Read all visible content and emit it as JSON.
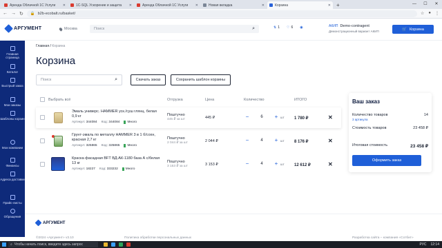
{
  "browser": {
    "tabs": [
      {
        "label": "Аренда Облачной 1С Услуги",
        "active": false,
        "icon": "red-square-icon"
      },
      {
        "label": "1С-SQL Ускорение и защита",
        "active": false,
        "icon": "red-square-icon"
      },
      {
        "label": "Аренда Облачной 1С Услуги",
        "active": false,
        "icon": "red-square-icon"
      },
      {
        "label": "Новая вкладка",
        "active": false,
        "icon": "globe-icon"
      },
      {
        "label": "Корзина",
        "active": true,
        "icon": "blue-square-icon"
      }
    ],
    "new_tab": "+",
    "url": "b2b-ecobalt.ru/basket/"
  },
  "header": {
    "brand": "АРГУМЕНТ",
    "city": "Москва",
    "search_placeholder": "Поиск",
    "compare_count": "1",
    "favorites_count": "6",
    "account_name": "Demo-contragent",
    "account_tag": "АКИП",
    "account_role": "Демонстрационный вариант АКИП",
    "cart_label": "Корзина",
    "colors": {
      "accent": "#1f5fd8",
      "sidebar": "#0e2a7a"
    }
  },
  "sidebar": {
    "items": [
      {
        "label": "Главная страница",
        "icon": "home-icon"
      },
      {
        "label": "Каталог",
        "icon": "catalog-icon"
      },
      {
        "label": "Быстрый заказ",
        "icon": "lightning-icon"
      },
      {
        "label": "Мои заказы",
        "icon": "orders-icon"
      },
      {
        "label": "Шаблоны корзин",
        "icon": "templates-icon"
      },
      {
        "label": "Мои компании",
        "icon": "company-icon"
      },
      {
        "label": "Финансы",
        "icon": "finance-icon"
      },
      {
        "label": "Адреса доставки",
        "icon": "address-icon"
      },
      {
        "label": "Прайс-листы",
        "icon": "pricelist-icon"
      },
      {
        "label": "Обращения",
        "icon": "support-icon"
      }
    ]
  },
  "main": {
    "breadcrumb": {
      "home": "Главная",
      "sep": "/",
      "current": "Корзина"
    },
    "title": "Корзина",
    "search_placeholder": "Поиск",
    "download_button": "Скачать заказ",
    "save_template_button": "Сохранить шаблон корзины",
    "columns": {
      "select_all": "Выбрать всё",
      "shipment": "Отгрузка",
      "price": "Цена",
      "quantity": "Количество",
      "total": "ИТОГО"
    },
    "items": [
      {
        "name": "Эмаль универс. HAMMER уск./суш глянц. белая 0,9 кг",
        "article_label": "Артикул:",
        "article": "344084",
        "code_label": "Код:",
        "code": "344084",
        "stock": "Много",
        "ship": "Поштучно",
        "ship_sub": "445 ₽ за шт",
        "price": "445 ₽",
        "qty": "6",
        "unit": "шт",
        "total": "1 780 ₽"
      },
      {
        "name": "Грунт-эмаль по металлу HAMMER 3 в 1 б/сохн, красная 2,7 кг",
        "article_label": "Артикул:",
        "article": "325865",
        "code_label": "Код:",
        "code": "325865",
        "stock": "Много",
        "ship": "Поштучно",
        "ship_sub": "2 044 ₽ за шт",
        "price": "2 044 ₽",
        "qty": "4",
        "unit": "шт",
        "total": "8 176 ₽"
      },
      {
        "name": "Краска фасадная BFT ВД-АК-1180 база А с/белая 13 кг",
        "article_label": "Артикул:",
        "article": "18227",
        "code_label": "Код:",
        "code": "333232",
        "stock": "Много",
        "ship": "Поштучно",
        "ship_sub": "3 153 ₽ за шт",
        "price": "3 153 ₽",
        "qty": "4",
        "unit": "шт",
        "total": "12 612 ₽"
      }
    ]
  },
  "summary": {
    "title": "Ваш заказ",
    "count_label": "Количество товаров",
    "count_value": "14",
    "link": "3 артикула",
    "cost_label": "Стоимость товаров",
    "cost_value": "23 458 ₽",
    "final_label": "Итоговая стоимость",
    "final_value": "23 458 ₽",
    "order_button": "Оформить заказ"
  },
  "footer": {
    "brand": "АРГУМЕНТ",
    "copyright": "©2024 «Аргумент» v3.10",
    "policy": "Политика обработки персональных данных",
    "dev": "Разработка сайта – компания «Сотбит»"
  },
  "taskbar": {
    "search_placeholder": "Чтобы начать поиск, введите здесь запрос",
    "lang": "РУС",
    "time": "12:14"
  }
}
